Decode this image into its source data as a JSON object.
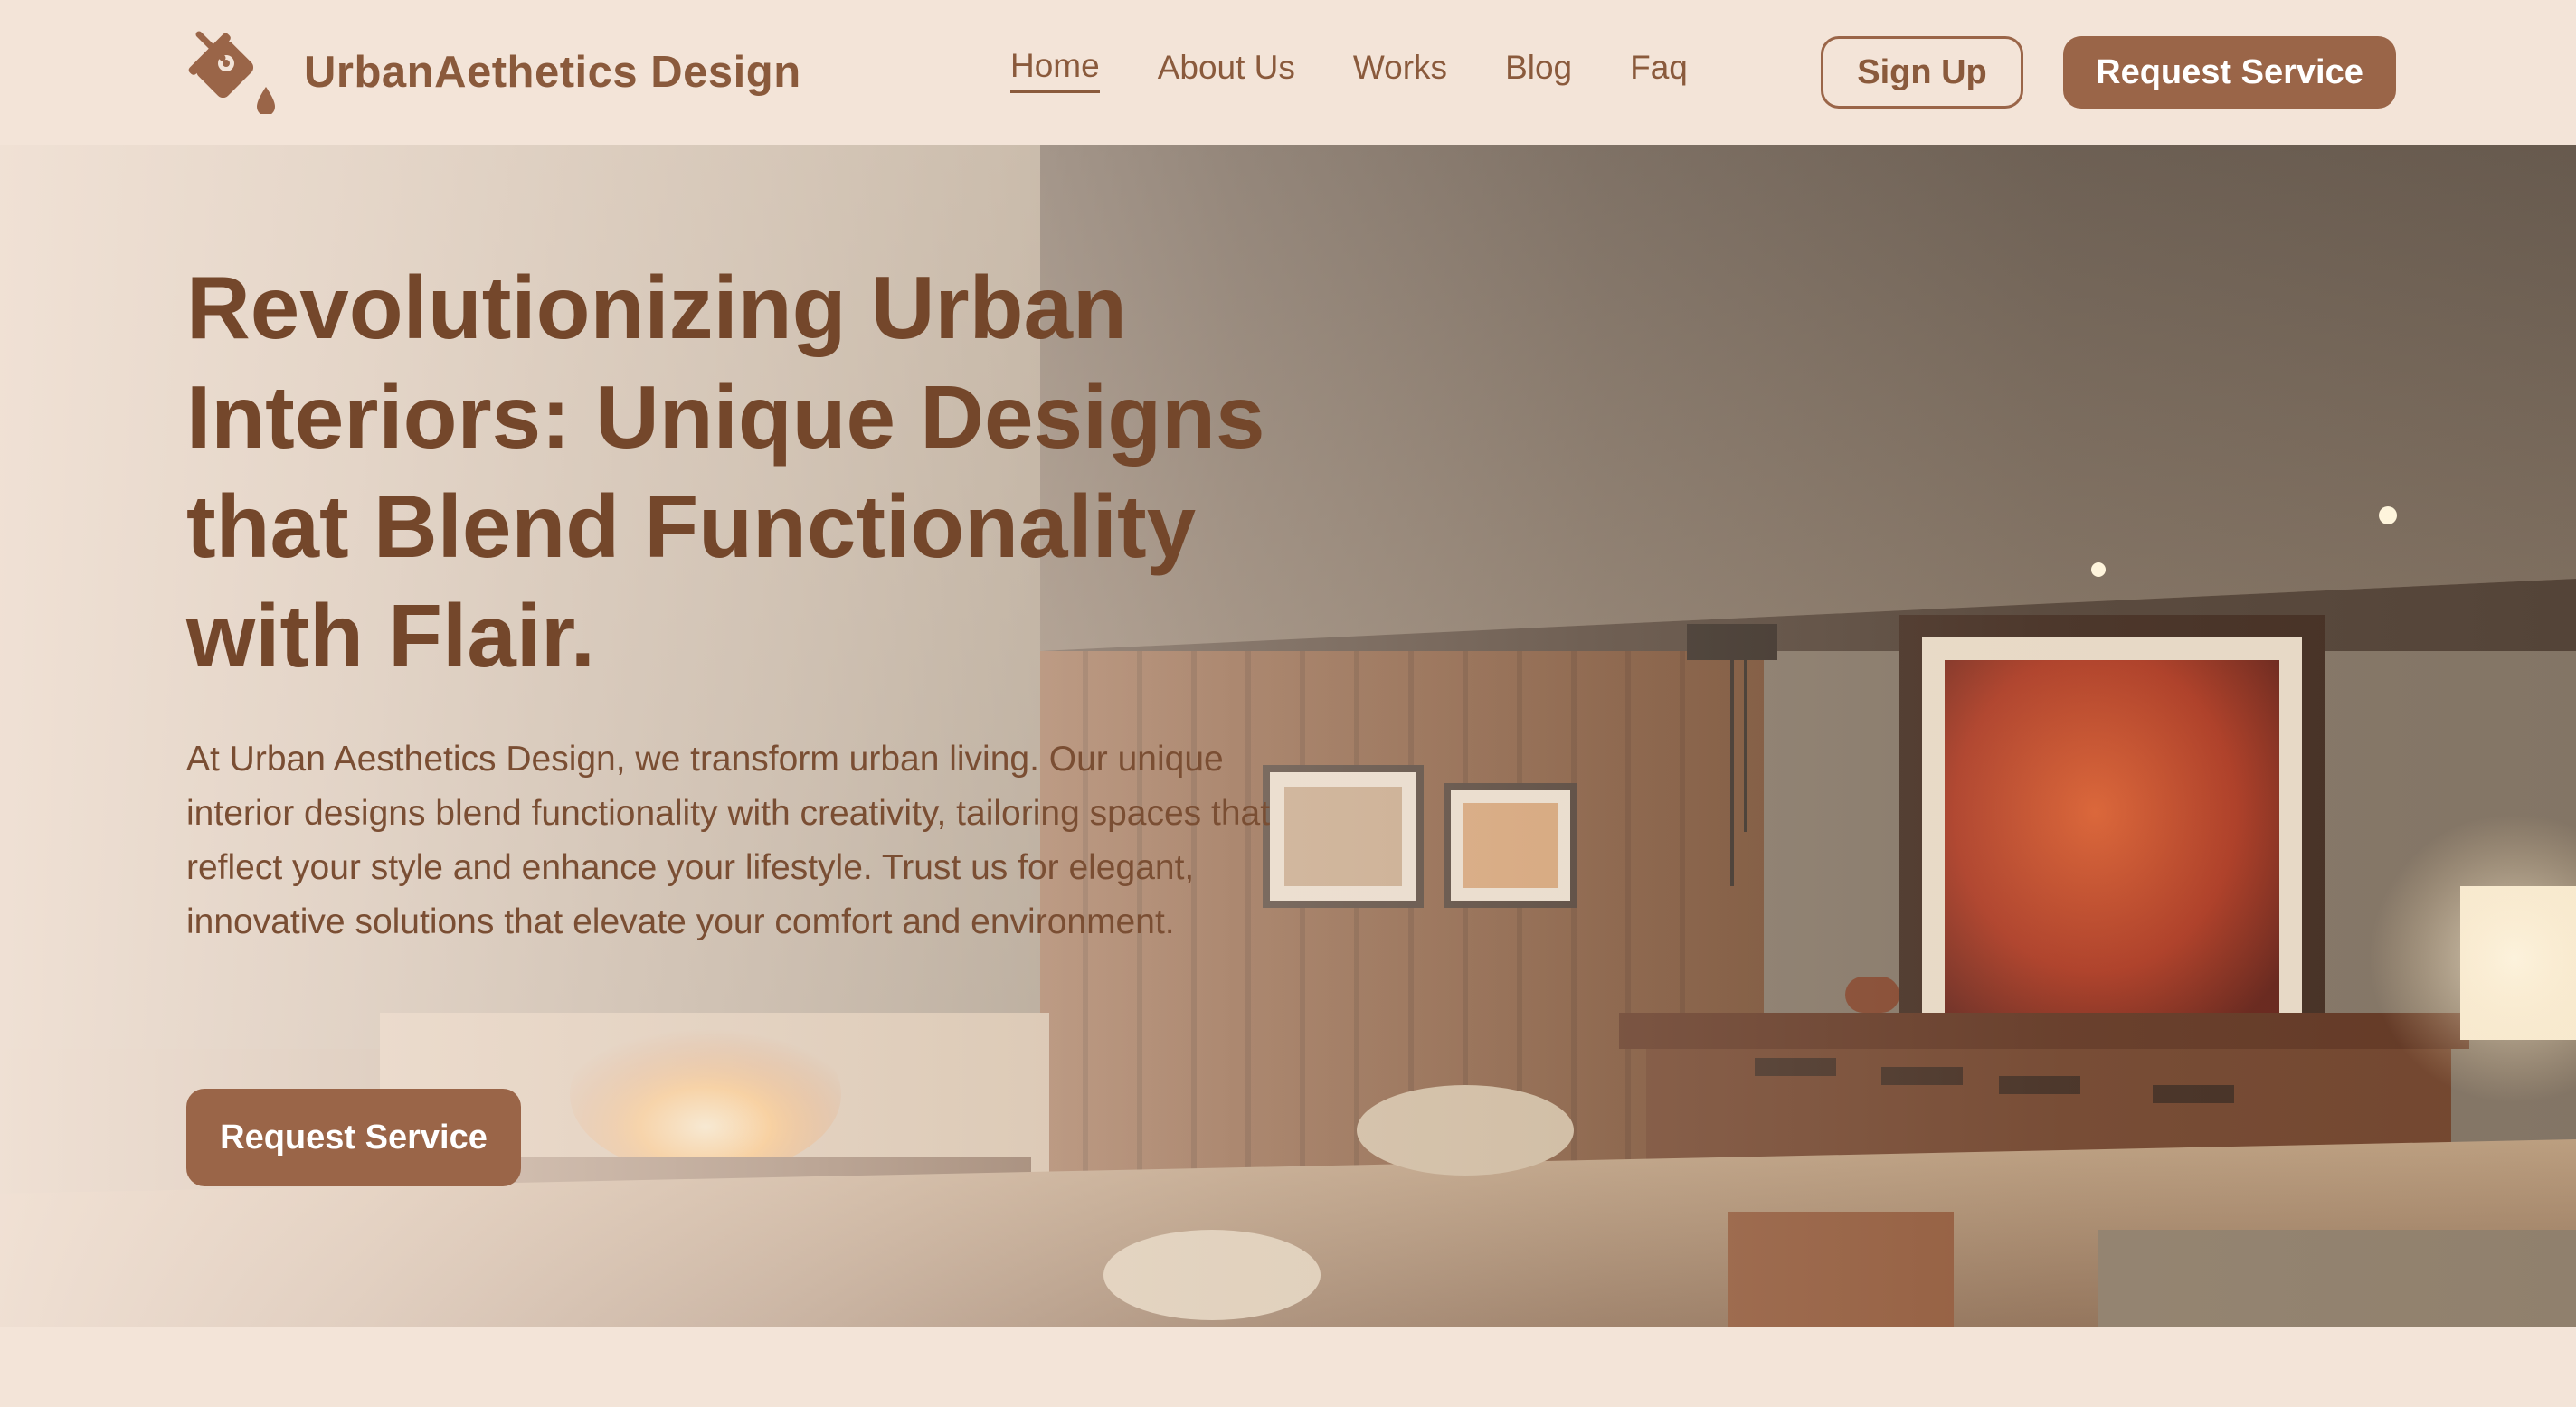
{
  "brand": {
    "name": "UrbanAethetics Design",
    "logo_icon": "paint-bucket-icon"
  },
  "nav": {
    "items": [
      {
        "label": "Home",
        "active": true
      },
      {
        "label": "About Us",
        "active": false
      },
      {
        "label": "Works",
        "active": false
      },
      {
        "label": "Blog",
        "active": false
      },
      {
        "label": "Faq",
        "active": false
      }
    ]
  },
  "header": {
    "signup_label": "Sign Up",
    "request_label": "Request Service"
  },
  "hero": {
    "title": "Revolutionizing Urban Interiors: Unique Designs that Blend Functionality with Flair.",
    "description": "At Urban Aesthetics Design, we transform urban living. Our unique interior designs blend functionality with creativity, tailoring spaces that reflect your style and enhance your lifestyle. Trust us for elegant, innovative solutions that elevate your comfort and environment.",
    "cta_label": "Request Service",
    "image": "modern-loft-interior-photo"
  },
  "colors": {
    "background": "#f3e4d8",
    "accent": "#9a6548",
    "text": "#74472b"
  }
}
